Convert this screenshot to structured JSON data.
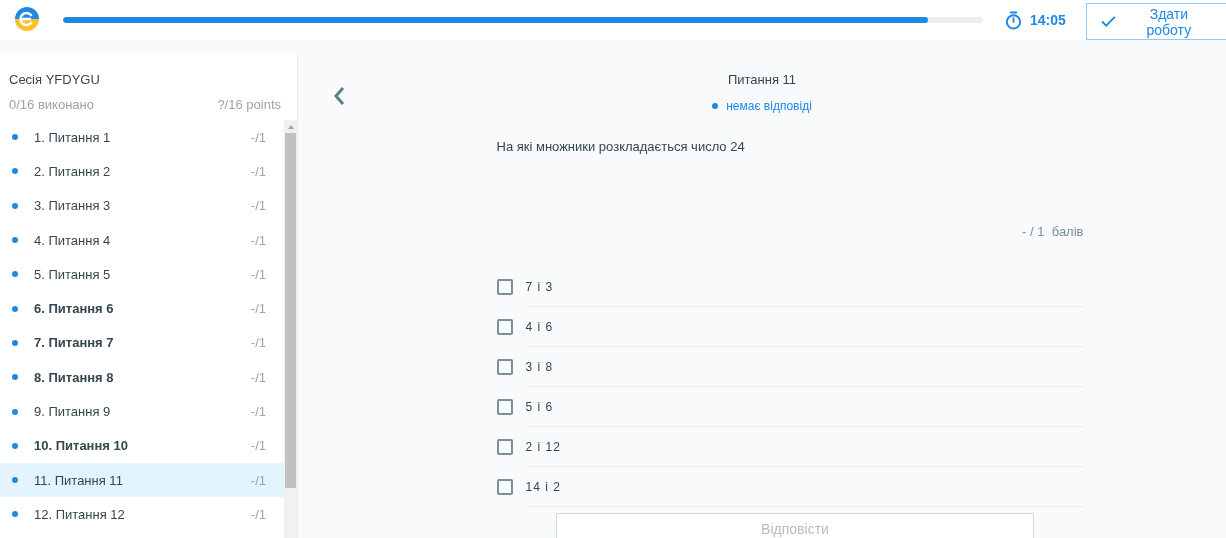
{
  "header": {
    "progress": {
      "level": 0.94
    },
    "timer": "14:05",
    "submit_button": "Здати роботу"
  },
  "sidebar": {
    "session": "Сесія YFDYGU",
    "done": "0/16 виконано",
    "points": "?/16 points",
    "items": [
      {
        "label": "1. Питання 1",
        "score": "-/1",
        "bold": false,
        "selected": false
      },
      {
        "label": "2. Питання 2",
        "score": "-/1",
        "bold": false,
        "selected": false
      },
      {
        "label": "3. Питання 3",
        "score": "-/1",
        "bold": false,
        "selected": false
      },
      {
        "label": "4. Питання 4",
        "score": "-/1",
        "bold": false,
        "selected": false
      },
      {
        "label": "5. Питання 5",
        "score": "-/1",
        "bold": false,
        "selected": false
      },
      {
        "label": "6. Питання 6",
        "score": "-/1",
        "bold": true,
        "selected": false
      },
      {
        "label": "7. Питання 7",
        "score": "-/1",
        "bold": true,
        "selected": false
      },
      {
        "label": "8. Питання 8",
        "score": "-/1",
        "bold": true,
        "selected": false
      },
      {
        "label": "9. Питання 9",
        "score": "-/1",
        "bold": false,
        "selected": false
      },
      {
        "label": "10. Питання 10",
        "score": "-/1",
        "bold": true,
        "selected": false
      },
      {
        "label": "11. Питання 11",
        "score": "-/1",
        "bold": false,
        "selected": true
      },
      {
        "label": "12. Питання 12",
        "score": "-/1",
        "bold": false,
        "selected": false
      }
    ]
  },
  "question": {
    "title": "Питання 11",
    "status": "немає відповіді",
    "text": "На які множники розкладається число 24",
    "score": "- / 1  балів",
    "options": [
      {
        "label": "7 і 3",
        "checked": false
      },
      {
        "label": "4 і 6",
        "checked": false
      },
      {
        "label": "3 і 8",
        "checked": false
      },
      {
        "label": "5 і 6",
        "checked": false
      },
      {
        "label": "2 і 12",
        "checked": false
      },
      {
        "label": "14 і 2",
        "checked": false
      }
    ],
    "answer_button": {
      "label": "Відповісти",
      "disabled": true
    }
  }
}
